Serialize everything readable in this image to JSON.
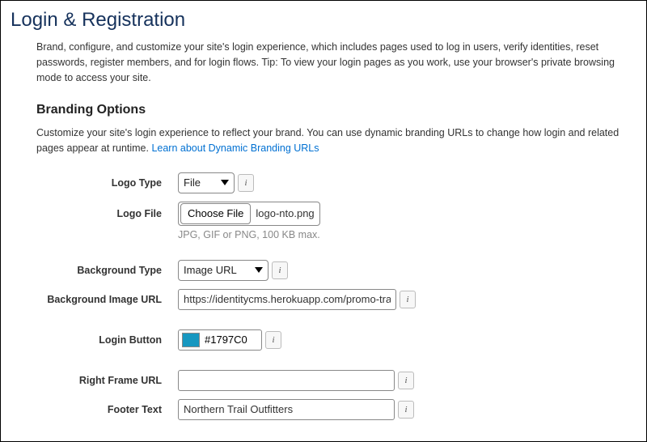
{
  "page": {
    "title": "Login & Registration",
    "description": "Brand, configure, and customize your site's login experience, which includes pages used to log in users, verify identities, reset passwords, register members, and for login flows. Tip: To view your login pages as you work, use your browser's private browsing mode to access your site."
  },
  "branding": {
    "section_title": "Branding Options",
    "desc_part1": "Customize your site's login experience to reflect your brand. You can use dynamic branding URLs to change how login and related pages appear at runtime. ",
    "desc_link": "Learn about Dynamic Branding URLs",
    "labels": {
      "logo_type": "Logo Type",
      "logo_file": "Logo File",
      "background_type": "Background Type",
      "background_url": "Background Image URL",
      "login_button": "Login Button",
      "right_frame_url": "Right Frame URL",
      "footer_text": "Footer Text"
    },
    "values": {
      "logo_type": "File",
      "logo_file_button": "Choose File",
      "logo_file_name": "logo-nto.png",
      "logo_file_hint": "JPG, GIF or PNG, 100 KB max.",
      "background_type": "Image URL",
      "background_url": "https://identitycms.herokuapp.com/promo-transp",
      "login_button_color": "#1797C0",
      "right_frame_url": "",
      "footer_text": "Northern Trail Outfitters"
    },
    "info_glyph": "i"
  }
}
